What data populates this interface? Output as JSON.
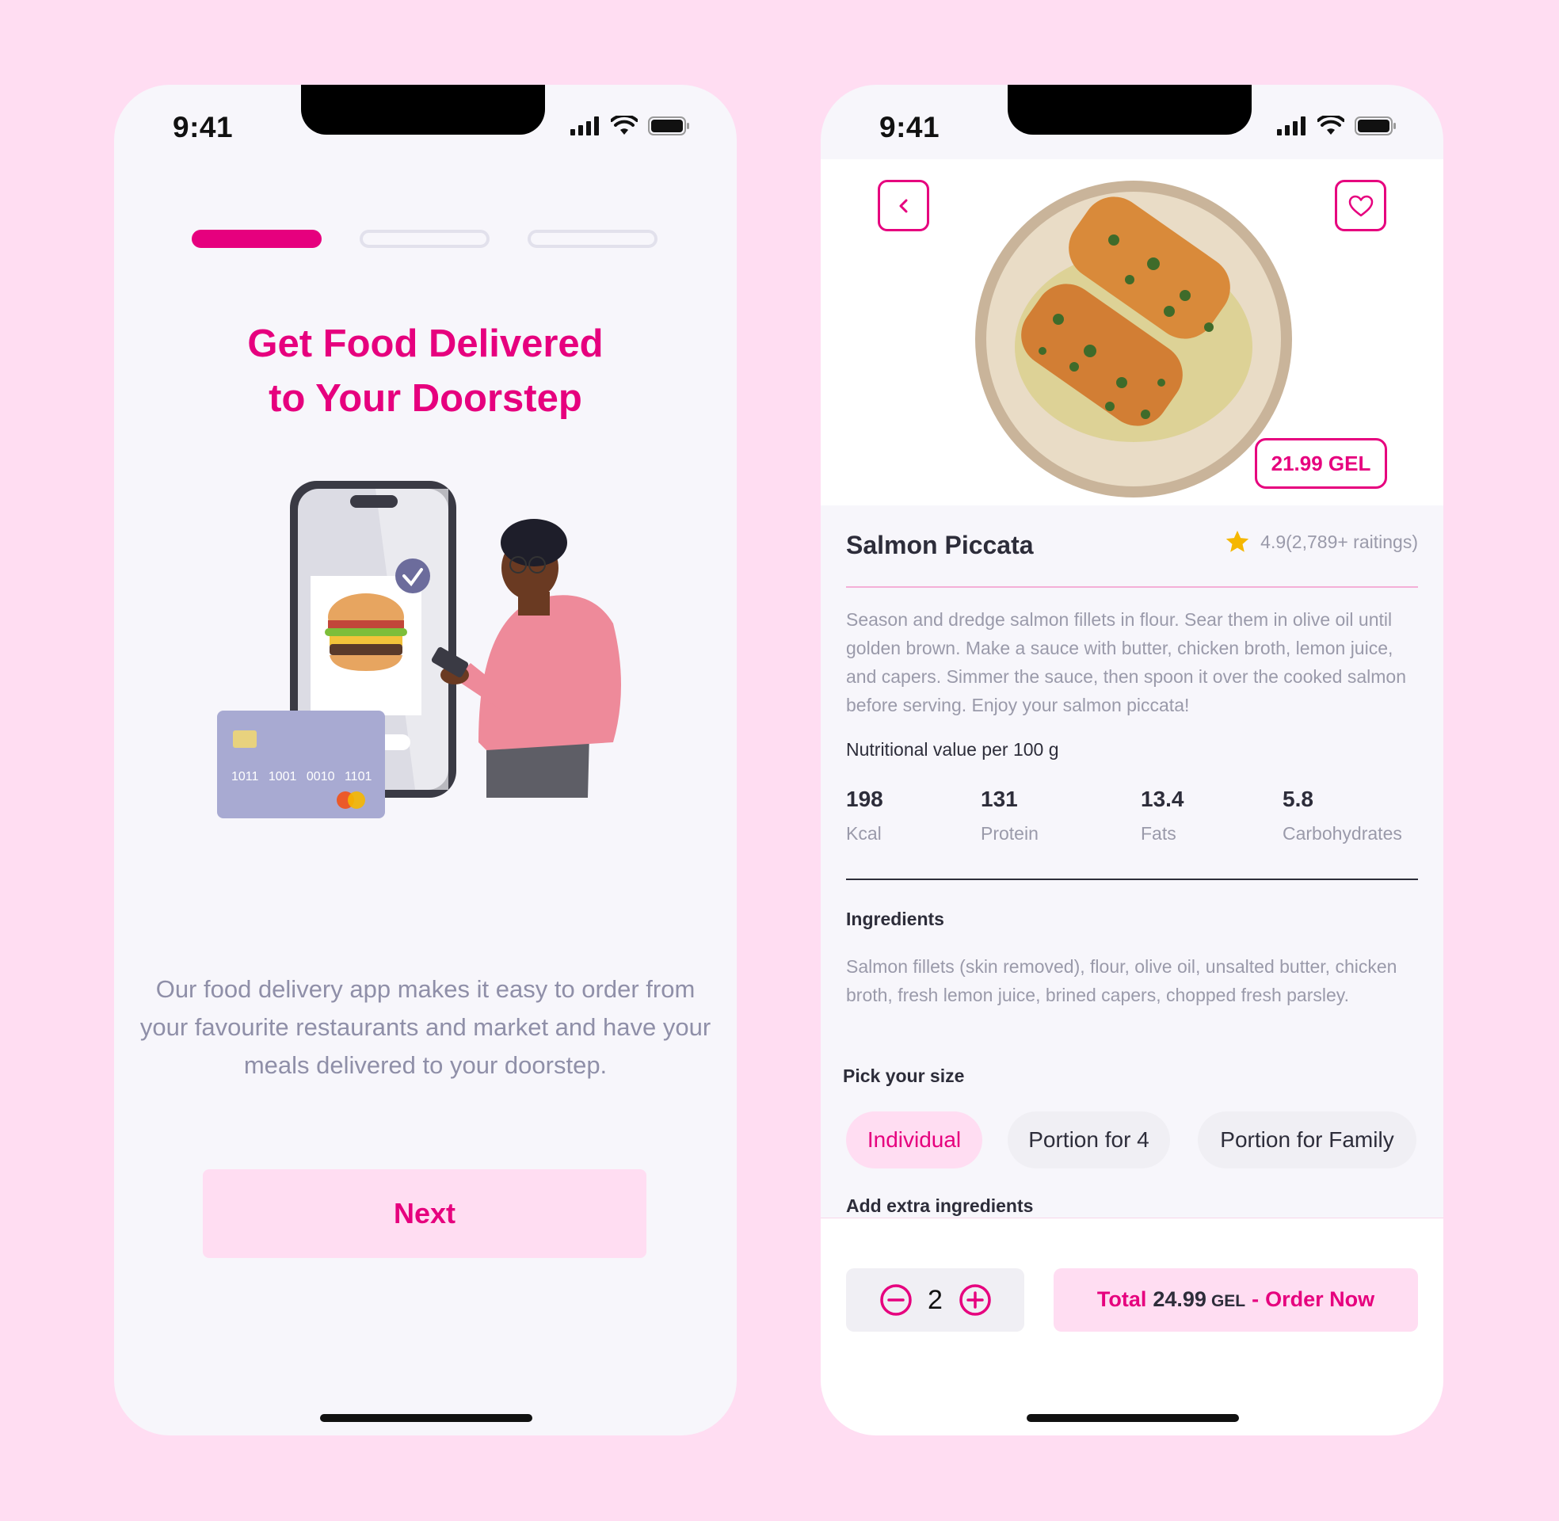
{
  "status_bar": {
    "time": "9:41"
  },
  "onboarding": {
    "progress": {
      "current_step": 1,
      "total_steps": 3
    },
    "title_line1": "Get Food Delivered",
    "title_line2": "to Your Doorstep",
    "description": "Our food delivery app makes it easy to order from your favourite restaurants and market and have your meals delivered to your doorstep.",
    "next_label": "Next",
    "illustration_card_digits": [
      "1011",
      "1001",
      "0010",
      "1101"
    ]
  },
  "detail": {
    "price": "21.99 GEL",
    "name": "Salmon Piccata",
    "rating": "4.9(2,789+ raitings)",
    "description": "Season and dredge salmon fillets in flour. Sear them in olive oil until golden brown. Make a sauce with butter, chicken broth, lemon juice, and capers. Simmer the sauce, then spoon it over the cooked salmon before serving. Enjoy your salmon piccata!",
    "nutrition_title": "Nutritional value per 100 g",
    "nutrition": [
      {
        "value": "198",
        "label": "Kcal"
      },
      {
        "value": "131",
        "label": "Protein"
      },
      {
        "value": "13.4",
        "label": "Fats"
      },
      {
        "value": "5.8",
        "label": "Carbohydrates"
      }
    ],
    "ingredients_title": "Ingredients",
    "ingredients": "Salmon fillets (skin removed), flour, olive oil, unsalted butter, chicken broth, fresh lemon juice, brined capers, chopped fresh parsley.",
    "size_title": "Pick your size",
    "sizes": [
      "Individual",
      "Portion for 4",
      "Portion for Family"
    ],
    "selected_size": "Individual",
    "extra_title": "Add extra ingredients",
    "quantity": "2",
    "order": {
      "total_label": "Total",
      "amount": "24.99",
      "currency": "GEL",
      "separator": "-",
      "action": "Order Now"
    }
  },
  "colors": {
    "accent": "#E6007E",
    "accent_soft": "#FFDDF2",
    "background": "#FFDDF2",
    "screen": "#F7F6FB"
  }
}
